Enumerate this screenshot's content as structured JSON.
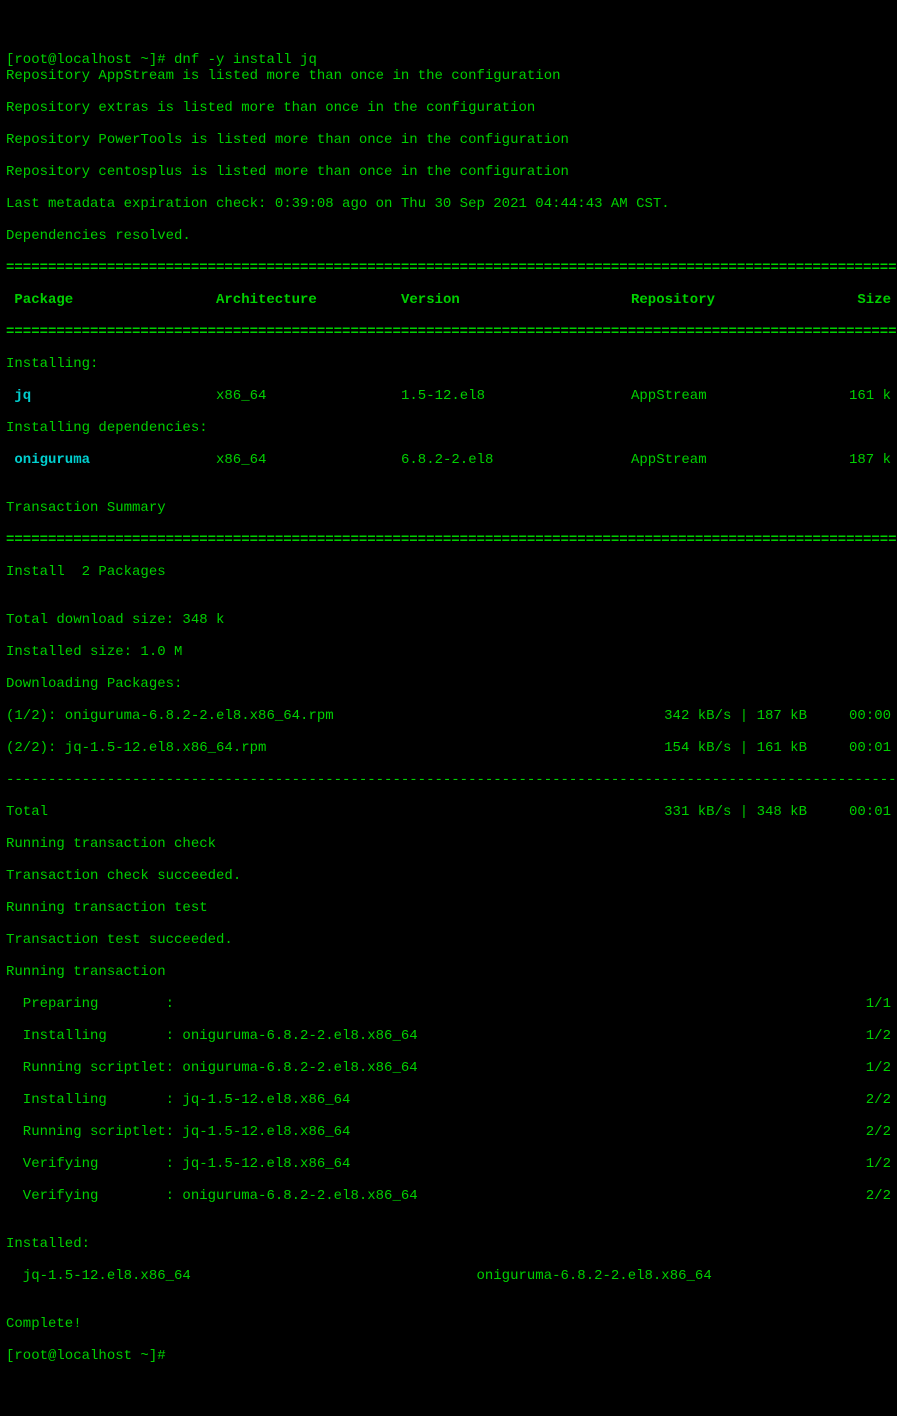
{
  "prompt1": "[root@localhost ~]# ",
  "command": "dnf -y install jq",
  "repo_warnings": [
    "Repository AppStream is listed more than once in the configuration",
    "Repository extras is listed more than once in the configuration",
    "Repository PowerTools is listed more than once in the configuration",
    "Repository centosplus is listed more than once in the configuration"
  ],
  "metadata_line": "Last metadata expiration check: 0:39:08 ago on Thu 30 Sep 2021 04:44:43 AM CST.",
  "deps_resolved": "Dependencies resolved.",
  "rule_dbl": "=========================================================================================================================",
  "rule_dash": "-------------------------------------------------------------------------------------------------------------------------",
  "header": {
    "pkg": " Package",
    "arch": "Architecture",
    "ver": "Version",
    "repo": "Repository",
    "size": "Size"
  },
  "installing_label": "Installing:",
  "pkg_jq": {
    "name": " jq",
    "arch": "x86_64",
    "ver": "1.5-12.el8",
    "repo": "AppStream",
    "size": "161 k"
  },
  "installing_deps_label": "Installing dependencies:",
  "pkg_onig": {
    "name": " oniguruma",
    "arch": "x86_64",
    "ver": "6.8.2-2.el8",
    "repo": "AppStream",
    "size": "187 k"
  },
  "tx_summary": "Transaction Summary",
  "install_count": "Install  2 Packages",
  "total_dl": "Total download size: 348 k",
  "installed_size": "Installed size: 1.0 M",
  "downloading": "Downloading Packages:",
  "dl1": {
    "left": "(1/2): oniguruma-6.8.2-2.el8.x86_64.rpm",
    "right": "342 kB/s | 187 kB     00:00"
  },
  "dl2": {
    "left": "(2/2): jq-1.5-12.el8.x86_64.rpm",
    "right": "154 kB/s | 161 kB     00:01"
  },
  "total": {
    "left": "Total",
    "right": "331 kB/s | 348 kB     00:01"
  },
  "tx_check1": "Running transaction check",
  "tx_check2": "Transaction check succeeded.",
  "tx_test1": "Running transaction test",
  "tx_test2": "Transaction test succeeded.",
  "tx_run": "Running transaction",
  "steps": [
    {
      "left": "  Preparing        :",
      "right": "1/1"
    },
    {
      "left": "  Installing       : oniguruma-6.8.2-2.el8.x86_64",
      "right": "1/2"
    },
    {
      "left": "  Running scriptlet: oniguruma-6.8.2-2.el8.x86_64",
      "right": "1/2"
    },
    {
      "left": "  Installing       : jq-1.5-12.el8.x86_64",
      "right": "2/2"
    },
    {
      "left": "  Running scriptlet: jq-1.5-12.el8.x86_64",
      "right": "2/2"
    },
    {
      "left": "  Verifying        : jq-1.5-12.el8.x86_64",
      "right": "1/2"
    },
    {
      "left": "  Verifying        : oniguruma-6.8.2-2.el8.x86_64",
      "right": "2/2"
    }
  ],
  "installed_hdr": "Installed:",
  "installed_line": "  jq-1.5-12.el8.x86_64                                  oniguruma-6.8.2-2.el8.x86_64",
  "complete": "Complete!",
  "prompt2": "[root@localhost ~]# "
}
